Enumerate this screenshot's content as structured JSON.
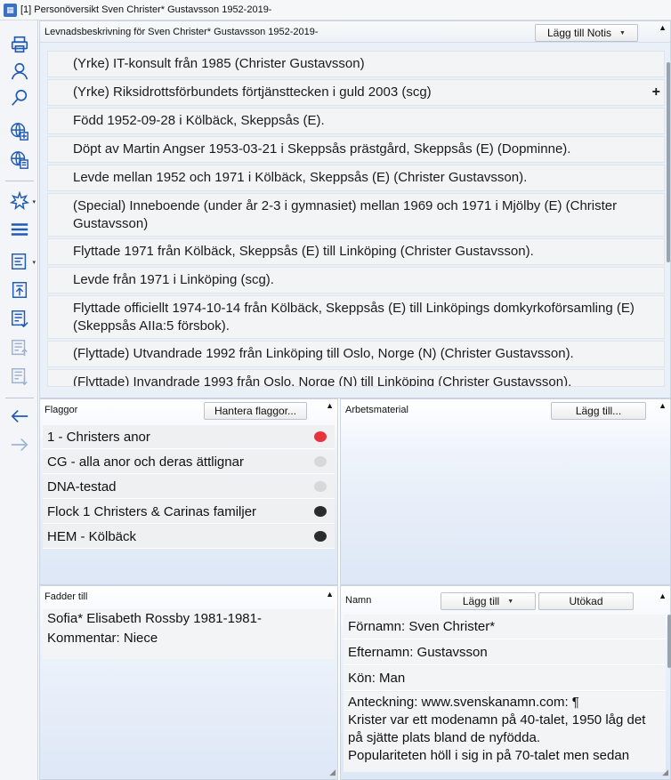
{
  "window": {
    "title": "[1] Personöversikt Sven Christer* Gustavsson 1952-2019-",
    "app_badge": "[1]"
  },
  "toolbar": {
    "icons": [
      "printer-icon",
      "person-search-icon",
      "search-icon",
      "globe-add-icon",
      "globe-doc-icon",
      "star-burst-icon",
      "menu-icon",
      "report-icon",
      "export-icon",
      "list-check-icon",
      "move-up-icon",
      "move-down-icon",
      "back-arrow-icon",
      "forward-arrow-icon"
    ]
  },
  "biography": {
    "title": "Levnadsbeskrivning för Sven Christer* Gustavsson 1952-2019-",
    "add_note_button": "Lägg till Notis",
    "items": [
      "(Yrke) IT-konsult från 1985 (Christer Gustavsson)",
      "(Yrke) Riksidrottsförbundets förtjänsttecken i guld 2003 (scg)",
      "Född 1952-09-28 i Kölbäck, Skeppsås (E).",
      "Döpt av Martin Angser 1953-03-21 i Skeppsås prästgård, Skeppsås (E) (Dopminne).",
      "Levde mellan 1952 och 1971 i Kölbäck, Skeppsås (E) (Christer Gustavsson).",
      "(Special) Inneboende (under år 2-3 i gymnasiet) mellan 1969 och 1971 i Mjölby (E) (Christer Gustavsson)",
      "Flyttade 1971 från Kölbäck, Skeppsås (E) till Linköping (Christer Gustavsson).",
      "Levde från 1971 i Linköping (scg).",
      "Flyttade officiellt 1974-10-14 från Kölbäck, Skeppsås (E) till Linköpings domkyrkoförsamling (E) (Skeppsås AIIa:5 försbok).",
      "(Flyttade) Utvandrade 1992 från Linköping till Oslo, Norge (N) (Christer Gustavsson).",
      "(Flyttade) Invandrade 1993 från Oslo, Norge (N) till Linköping (Christer Gustavsson)."
    ],
    "plus_label": "+"
  },
  "flags": {
    "title": "Flaggor",
    "manage_button": "Hantera flaggor...",
    "items": [
      {
        "label": "1 - Christers anor",
        "color": "#e8323c"
      },
      {
        "label": "CG  - alla anor och deras ättlignar",
        "color": "#d8d8d8"
      },
      {
        "label": "DNA-testad",
        "color": "#d8d8d8"
      },
      {
        "label": "Flock 1 Christers & Carinas familjer",
        "color": "#2b2b2b"
      },
      {
        "label": "HEM - Kölbäck",
        "color": "#2b2b2b"
      }
    ]
  },
  "work_material": {
    "title": "Arbetsmaterial",
    "add_button": "Lägg till..."
  },
  "godparent": {
    "title": "Fadder till",
    "line1": "Sofia* Elisabeth  Rossby 1981-1981-",
    "line2": "Kommentar: Niece"
  },
  "names": {
    "title": "Namn",
    "add_button": "Lägg till",
    "extended_button": "Utökad",
    "first_name": "Förnamn: Sven Christer*",
    "last_name": "Efternamn: Gustavsson",
    "gender": "Kön: Man",
    "note_lines": [
      "Anteckning: www.svenskanamn.com: ¶",
      "Krister var ett modenamn på 40-talet, 1950 låg det",
      "på sjätte plats bland de nyfödda.",
      "Populariteten höll i sig in på 70-talet men sedan"
    ]
  }
}
